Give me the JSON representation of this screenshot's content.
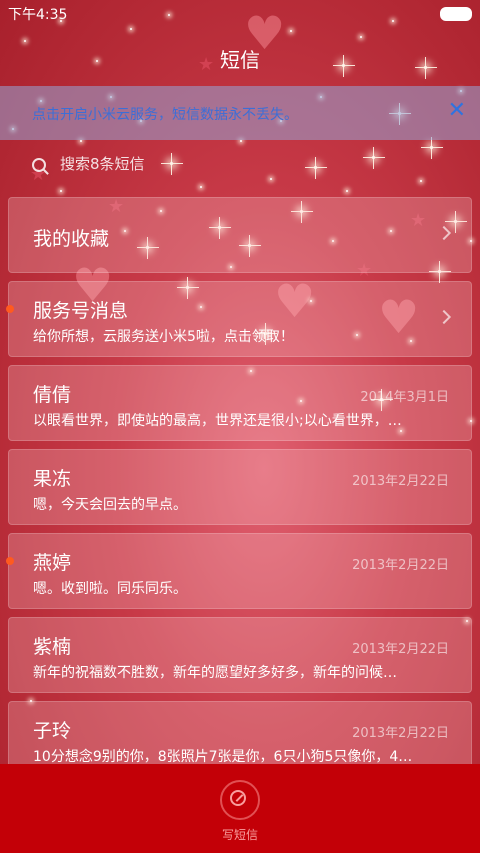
{
  "status_bar": {
    "time": "下午4:35"
  },
  "header": {
    "title": "短信"
  },
  "banner": {
    "text": "点击开启小米云服务，短信数据永不丢失。",
    "close": "✕"
  },
  "search": {
    "placeholder": "搜索8条短信"
  },
  "conversations": [
    {
      "name": "我的收藏",
      "preview": "",
      "date": "",
      "unread": false,
      "chevron": true
    },
    {
      "name": "服务号消息",
      "preview": "给你所想，云服务送小米5啦，点击领取！",
      "date": "",
      "unread": true,
      "chevron": true
    },
    {
      "name": "倩倩",
      "preview": "以眼看世界，即使站的最高，世界还是很小;以心看世界，…",
      "date": "2014年3月1日",
      "unread": false,
      "chevron": false
    },
    {
      "name": "果冻",
      "preview": "嗯，今天会回去的早点。",
      "date": "2013年2月22日",
      "unread": false,
      "chevron": false
    },
    {
      "name": "燕婷",
      "preview": "嗯。收到啦。同乐同乐。",
      "date": "2013年2月22日",
      "unread": true,
      "chevron": false
    },
    {
      "name": "紫楠",
      "preview": "新年的祝福数不胜数，新年的愿望好多好多，新年的问候…",
      "date": "2013年2月22日",
      "unread": false,
      "chevron": false
    },
    {
      "name": "子玲",
      "preview": "10分想念9别的你，8张照片7张是你，6只小狗5只像你，4…",
      "date": "2013年2月22日",
      "unread": false,
      "chevron": false
    }
  ],
  "bottom_bar": {
    "compose_label": "写短信",
    "compose_icon": "compose-icon"
  },
  "colors": {
    "banner_text": "#3d6ed6",
    "unread_dot": "#ff5a1f",
    "bottom_bar": "#c30007"
  }
}
